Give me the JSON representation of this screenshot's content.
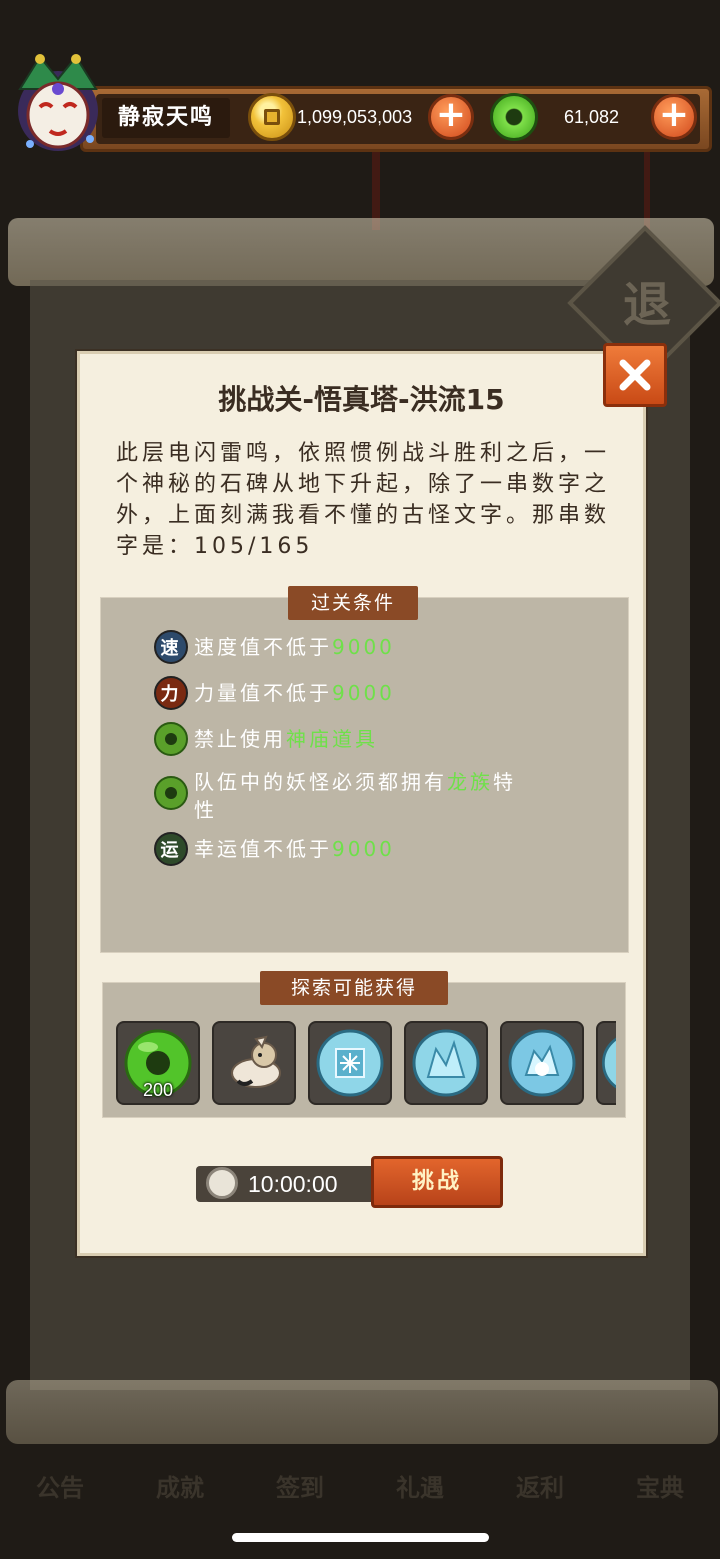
{
  "player": {
    "name": "静寂天鸣",
    "gold": "1,099,053,003",
    "jade": "61,082"
  },
  "background": {
    "retreat_label": "退",
    "nav_items": [
      "公告",
      "成就",
      "签到",
      "礼遇",
      "返利",
      "宝典"
    ]
  },
  "dialog": {
    "title": "挑战关-悟真塔-洪流15",
    "description": "此层电闪雷鸣，依照惯例战斗胜利之后，一个神秘的石碑从地下升起，除了一串数字之外，上面刻满我看不懂的古怪文字。那串数字是：105/165",
    "conditions_header": "过关条件",
    "conditions": [
      {
        "icon": "速",
        "text": "速度值不低于",
        "highlight": "9000",
        "suffix": "",
        "color": "#2d4a6b"
      },
      {
        "icon": "力",
        "text": "力量值不低于",
        "highlight": "9000",
        "suffix": "",
        "color": "#7a2a12"
      },
      {
        "icon": "",
        "text": "禁止使用",
        "highlight": "神庙道具",
        "suffix": "",
        "color": "#5aa02a"
      },
      {
        "icon": "",
        "text": "队伍中的妖怪必须都拥有",
        "highlight": "龙族",
        "suffix": "特性",
        "color": "#5aa02a"
      },
      {
        "icon": "运",
        "text": "幸运值不低于",
        "highlight": "9000",
        "suffix": "",
        "color": "#2e4a2a"
      }
    ],
    "rewards_header": "探索可能获得",
    "rewards": [
      {
        "icon": "jade-coin-icon",
        "count": "200"
      },
      {
        "icon": "hamster-pet-icon",
        "count": ""
      },
      {
        "icon": "snowflake-orb-icon",
        "count": ""
      },
      {
        "icon": "ice-crystal-orb-icon",
        "count": ""
      },
      {
        "icon": "frost-orb-icon",
        "count": ""
      },
      {
        "icon": "orb-icon",
        "count": ""
      }
    ],
    "timer": "10:00:00",
    "challenge_label": "挑战"
  }
}
